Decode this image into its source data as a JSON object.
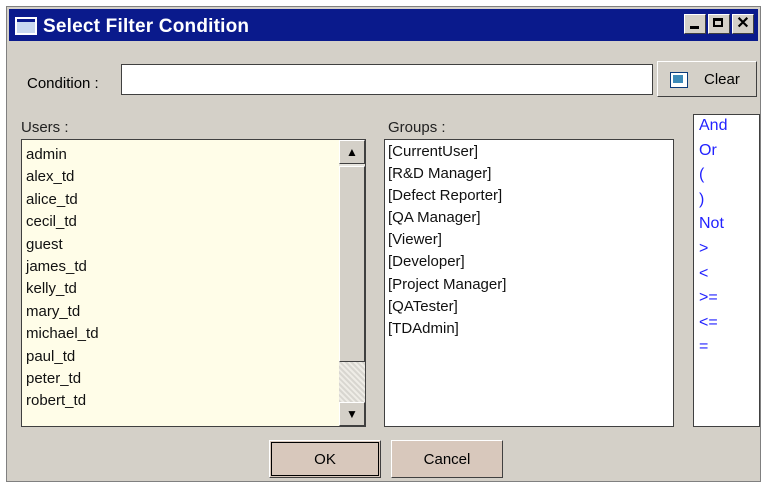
{
  "window": {
    "title": "Select Filter Condition",
    "icon": "window-icon"
  },
  "condition": {
    "label": "Condition :",
    "value": "",
    "clear_label": "Clear"
  },
  "users": {
    "label": "Users :",
    "items": [
      "admin",
      "alex_td",
      "alice_td",
      "cecil_td",
      "guest",
      "james_td",
      "kelly_td",
      "mary_td",
      "michael_td",
      "paul_td",
      "peter_td",
      "robert_td"
    ]
  },
  "groups": {
    "label": "Groups :",
    "items": [
      "[CurrentUser]",
      "[R&D Manager]",
      "[Defect Reporter]",
      "[QA Manager]",
      "[Viewer]",
      "[Developer]",
      "[Project Manager]",
      "[QATester]",
      "[TDAdmin]"
    ]
  },
  "operators": {
    "items": [
      "And",
      "Or",
      "(",
      ")",
      "Not",
      ">",
      "<",
      ">=",
      "<=",
      "="
    ]
  },
  "buttons": {
    "ok": "OK",
    "cancel": "Cancel"
  },
  "colors": {
    "titlebar": "#0a1a8c",
    "operator_text": "#2222ff",
    "users_bg": "#fffde8"
  }
}
